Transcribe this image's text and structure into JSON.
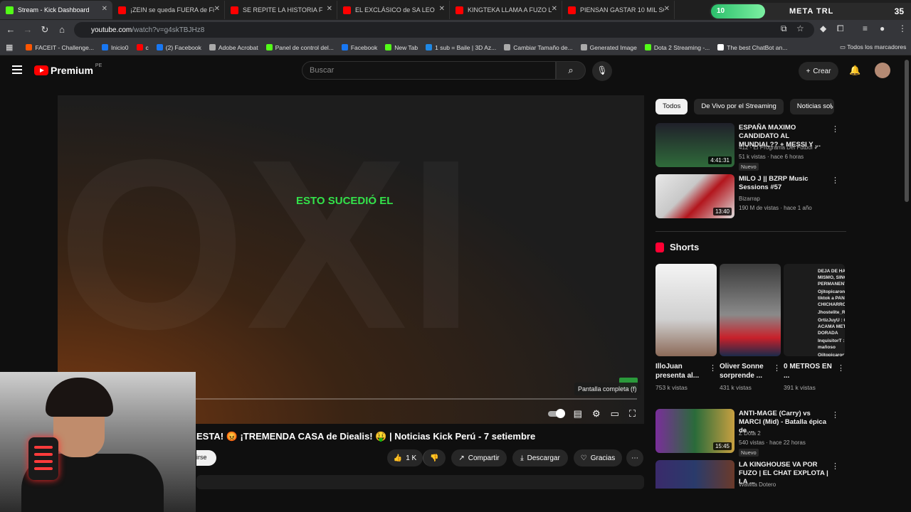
{
  "tabs": [
    {
      "label": "Stream - Kick Dashboard",
      "color": "#53fc18"
    },
    {
      "label": "¡ZEIN se queda FUERA de Fi",
      "color": "#ff0000"
    },
    {
      "label": "SE REPITE LA HISTORIA F",
      "color": "#ff0000"
    },
    {
      "label": "EL EXCLÁSICO de SA LEO",
      "color": "#ff0000"
    },
    {
      "label": "KINGTEKA LLAMA A FUZO LO",
      "color": "#ff0000"
    },
    {
      "label": "PIENSAN GASTAR 10 MIL SO",
      "color": "#ff0000"
    }
  ],
  "meta": {
    "level": "10",
    "goal": "META TRL",
    "count": "35",
    "progress_fraction": 0.27
  },
  "address": {
    "host": "youtube.com",
    "path": "/watch?v=g4skTBJHz8"
  },
  "bookmarks": [
    {
      "label": "FACEIT - Challenge...",
      "color": "#ff5500"
    },
    {
      "label": "Inicio0",
      "color": "#1877f2"
    },
    {
      "label": "c",
      "color": "#ff0000"
    },
    {
      "label": "(2) Facebook",
      "color": "#1877f2"
    },
    {
      "label": "Adobe Acrobat",
      "color": "#aaaaaa"
    },
    {
      "label": "Panel de control del...",
      "color": "#53fc18"
    },
    {
      "label": "Facebook",
      "color": "#1877f2"
    },
    {
      "label": "New Tab",
      "color": "#53fc18"
    },
    {
      "label": "1 sub = Baile | 3D Az...",
      "color": "#1e88e5"
    },
    {
      "label": "Cambiar Tamaño de...",
      "color": "#aaaaaa"
    },
    {
      "label": "Generated Image",
      "color": "#aaaaaa"
    },
    {
      "label": "Dota 2 Streaming -...",
      "color": "#53fc18"
    },
    {
      "label": "The best ChatBot an...",
      "color": "#ffffff"
    }
  ],
  "all_bookmarks": "Todos los marcadores",
  "youtube": {
    "brand": "Premium",
    "region": "PE",
    "search_placeholder": "Buscar",
    "create_label": "Crear"
  },
  "player": {
    "bg_text": "OXI",
    "caption": "ESTO SUCEDIÓ EL",
    "tooltip": "Pantalla completa (f)"
  },
  "video": {
    "title": "ESTA! 😡 ¡TREMENDA CASA de Diealis! 🤑 | Noticias Kick Perú - 7 setiembre",
    "subscribe": "irse",
    "likes": "1 K",
    "share": "Compartir",
    "download": "Descargar",
    "thanks": "Gracias"
  },
  "chips": [
    "Todos",
    "De Vivo por el Streaming",
    "Noticias sol"
  ],
  "recommended": [
    {
      "title": "ESPAÑA MAXIMO CANDIDATO AL MUNDIAL?? + MESSI Y ...",
      "channel": "412 - El Programa Del Fútbol",
      "meta": "51 k vistas · hace 6 horas",
      "badge": "Nuevo",
      "duration": "4:41:31",
      "thumb": "#2f6b3a"
    },
    {
      "title": "MILO J || BZRP Music Sessions #57",
      "channel": "Bizarrap",
      "meta": "190 M de vistas · hace 1 año",
      "badge": "",
      "duration": "13:40",
      "thumb": "#b3161d"
    }
  ],
  "shorts": {
    "heading": "Shorts",
    "items": [
      {
        "title": "IlloJuan presenta al...",
        "views": "753 k vistas",
        "thumb": "#dcdcdc"
      },
      {
        "title": "Oliver Sonne sorprende ...",
        "views": "431 k vistas",
        "thumb": "#8a8a8a"
      },
      {
        "title": "0 METROS EN ...",
        "views": "391 k vistas",
        "thumb": "#1c1c1c"
      }
    ],
    "overlay_lines": [
      "DEJA DE HABLAR DE LO MISMO, SINO DE BAN PERMANENTE",
      "Ojitopicaron007 : ee intra a tiktok a PAN CON CHICHARRON",
      "Jhostelite_R : xd",
      "OrtizJuyU : QUIERO VER A ACAMA METO EN NOCHE DORADA",
      "InquisitorT : no seas mañoso",
      "Ojitopicaron007 : TIKTOK Y TWIT"
    ]
  },
  "more_videos": [
    {
      "title": "ANTI-MAGE (Carry) vs MARCI (Mid) - Batalla épica de ...",
      "channel": "Z Dota 2",
      "meta": "540 vistas · hace 22 horas",
      "badge": "Nuevo",
      "duration": "15:45",
      "thumb": "#5a2e7a"
    },
    {
      "title": "LA KINGHOUSE VA POR FUZO | EL CHAT EXPLOTA | LA ...",
      "channel": "Wawita Dotero",
      "meta": "",
      "badge": "",
      "duration": "",
      "thumb": "#2a3b6b"
    }
  ]
}
